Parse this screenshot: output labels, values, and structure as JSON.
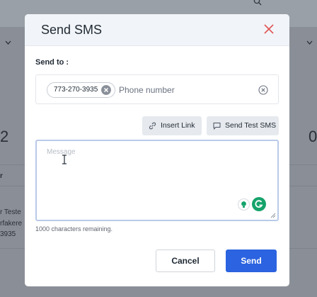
{
  "background": {
    "left_number": "2",
    "right_number": "0",
    "left_header_fragment": "r",
    "left_name_fragment": "r Teste",
    "left_sub_fragment": "rfakere",
    "left_phone_fragment": "3935"
  },
  "modal": {
    "title": "Send SMS",
    "send_to_label": "Send to :",
    "recipients": [
      {
        "phone": "773-270-3935"
      }
    ],
    "phone_placeholder": "Phone number",
    "insert_link_label": "Insert Link",
    "send_test_label": "Send Test SMS",
    "message_placeholder": "Message",
    "chars_remaining": "1000 characters remaining.",
    "cancel_label": "Cancel",
    "send_label": "Send"
  },
  "colors": {
    "primary": "#2b63e0",
    "grammarly": "#15a36b",
    "close": "#e05252"
  }
}
